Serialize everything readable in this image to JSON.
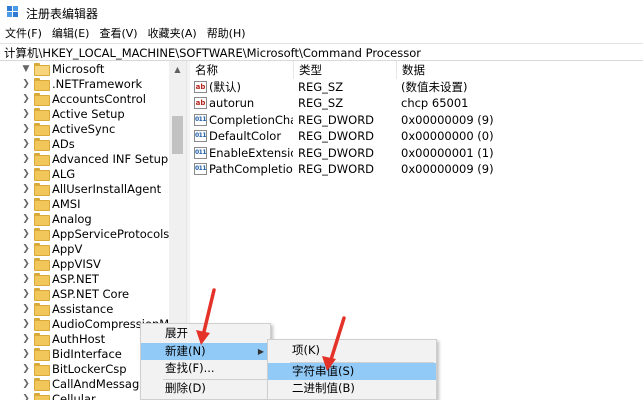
{
  "window": {
    "title": "注册表编辑器"
  },
  "menubar": [
    "文件(F)",
    "编辑(E)",
    "查看(V)",
    "收藏夹(A)",
    "帮助(H)"
  ],
  "address": "计算机\\HKEY_LOCAL_MACHINE\\SOFTWARE\\Microsoft\\Command Processor",
  "tree": {
    "root": "Microsoft",
    "items": [
      ".NETFramework",
      "AccountsControl",
      "Active Setup",
      "ActiveSync",
      "ADs",
      "Advanced INF Setup",
      "ALG",
      "AllUserInstallAgent",
      "AMSI",
      "Analog",
      "AppServiceProtocols",
      "AppV",
      "AppVISV",
      "ASP.NET",
      "ASP.NET Core",
      "Assistance",
      "AudioCompressionM",
      "AuthHost",
      "BidInterface",
      "BitLockerCsp",
      "CallAndMessaging",
      "Cellular"
    ]
  },
  "columns": {
    "name": "名称",
    "type": "类型",
    "data": "数据"
  },
  "values": [
    {
      "icon": "ab",
      "name": "(默认)",
      "type": "REG_SZ",
      "data": "(数值未设置)"
    },
    {
      "icon": "ab",
      "name": "autorun",
      "type": "REG_SZ",
      "data": "chcp 65001"
    },
    {
      "icon": "bin",
      "name": "CompletionChar",
      "type": "REG_DWORD",
      "data": "0x00000009 (9)"
    },
    {
      "icon": "bin",
      "name": "DefaultColor",
      "type": "REG_DWORD",
      "data": "0x00000000 (0)"
    },
    {
      "icon": "bin",
      "name": "EnableExtensions",
      "type": "REG_DWORD",
      "data": "0x00000001 (1)"
    },
    {
      "icon": "bin",
      "name": "PathCompletionChar",
      "type": "REG_DWORD",
      "data": "0x00000009 (9)"
    }
  ],
  "context_menu": {
    "items": [
      "展开",
      "新建(N)",
      "查找(F)...",
      "删除(D)"
    ],
    "highlighted": "新建(N)"
  },
  "submenu": {
    "items": [
      "项(K)",
      "字符串值(S)",
      "二进制值(B)"
    ],
    "highlighted": "字符串值(S)"
  },
  "colors": {
    "highlight": "#91c9f7",
    "arrow": "#e53228",
    "folder": "#f1c75b"
  }
}
